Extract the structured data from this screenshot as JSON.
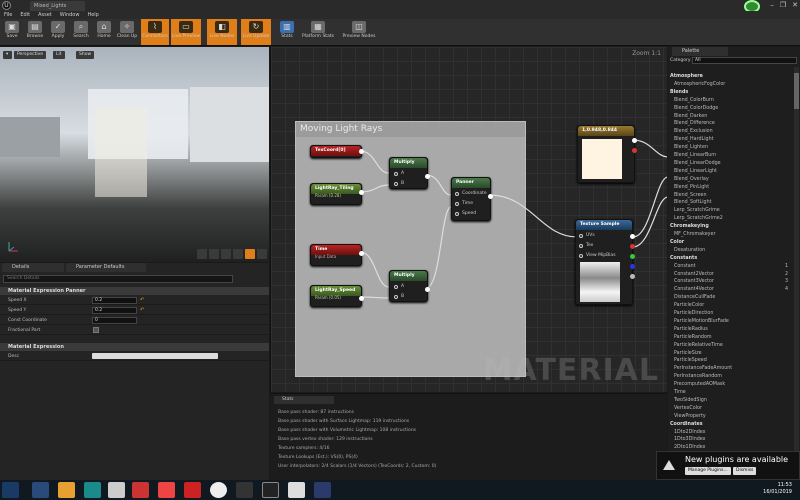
{
  "titlebar": {
    "tab_title": "Mixed_Lights",
    "window_controls": [
      "–",
      "❐",
      "✕"
    ]
  },
  "menu": [
    "File",
    "Edit",
    "Asset",
    "Window",
    "Help"
  ],
  "toolbar": [
    {
      "label": "Save",
      "icon": "save-icon",
      "active": false
    },
    {
      "label": "Browse",
      "icon": "browse-icon",
      "active": false
    },
    {
      "label": "Apply",
      "icon": "apply-icon",
      "active": false
    },
    {
      "label": "Search",
      "icon": "search-icon",
      "active": false
    },
    {
      "label": "Home",
      "icon": "home-icon",
      "active": false
    },
    {
      "label": "Clean Up",
      "icon": "cleanup-icon",
      "active": false
    },
    {
      "label": "Connectors",
      "icon": "connectors-icon",
      "active": true
    },
    {
      "label": "Live Preview",
      "icon": "live-preview-icon",
      "active": true
    },
    {
      "label": "Live Nodes",
      "icon": "live-nodes-icon",
      "active": true
    },
    {
      "label": "Live Update",
      "icon": "live-update-icon",
      "active": true
    },
    {
      "label": "Stats",
      "icon": "stats-icon",
      "active": false
    },
    {
      "label": "Platform Stats",
      "icon": "platform-stats-icon",
      "active": false
    },
    {
      "label": "Preview Nodes",
      "icon": "preview-nodes-icon",
      "active": false
    }
  ],
  "viewport": {
    "perspective": "Perspective",
    "lit": "Lit",
    "show": "Show"
  },
  "details": {
    "tab1": "Details",
    "tab2": "Parameter Defaults",
    "search_placeholder": "Search Details",
    "section1": "Material Expression Panner",
    "rows": [
      {
        "label": "Speed X",
        "value": "0.2"
      },
      {
        "label": "Speed Y",
        "value": "0.2"
      },
      {
        "label": "Const Coordinate",
        "value": "0"
      },
      {
        "label": "Fractional Part",
        "value": ""
      }
    ],
    "section2": "Material Expression",
    "desc_label": "Desc"
  },
  "graph": {
    "zoom": "Zoom 1:1",
    "watermark": "MATERIAL",
    "comment": "Moving Light Rays",
    "nodes": {
      "texcoord": "TexCoord[0]",
      "tiling": "LightRay_Tiling",
      "tiling_sub": "Param (0.28)",
      "time": "Time",
      "time_sub": "Input Data",
      "speed": "LightRay_Speed",
      "speed_sub": "Param (0.05)",
      "multiply1": "Multiply",
      "multiply2": "Multiply",
      "panner": "Panner",
      "pin_a": "A",
      "pin_b": "B",
      "pin_coordinate": "Coordinate",
      "pin_time": "Time",
      "pin_speed": "Speed",
      "color": "1,0.948,0.844",
      "texsample": "Texture Sample",
      "pin_uvs": "UVs",
      "pin_tex": "Tex",
      "pin_mip": "View MipBias"
    }
  },
  "log": {
    "tab": "Stats",
    "lines": [
      "Base pass shader: 87 instructions",
      "Base pass shader with Surface Lightmap: 119 instructions",
      "Base pass shader with Volumetric Lightmap: 108 instructions",
      "Base pass vertex shader: 129 instructions",
      "Texture samplers: 4/16",
      "Texture Lookups (Est.): VS(0), PS(4)",
      "User interpolators: 2/4 Scalars (1/4 Vectors) (TexCoords: 2, Custom: 0)"
    ]
  },
  "palette": {
    "tab": "Palette",
    "category_label": "Category",
    "category_value": "All",
    "items": [
      {
        "t": "cat",
        "l": "Atmosphere"
      },
      {
        "t": "item",
        "l": "AtmosphericFogColor"
      },
      {
        "t": "cat",
        "l": "Blends"
      },
      {
        "t": "item",
        "l": "Blend_ColorBurn"
      },
      {
        "t": "item",
        "l": "Blend_ColorDodge"
      },
      {
        "t": "item",
        "l": "Blend_Darken"
      },
      {
        "t": "item",
        "l": "Blend_Difference"
      },
      {
        "t": "item",
        "l": "Blend_Exclusion"
      },
      {
        "t": "item",
        "l": "Blend_HardLight"
      },
      {
        "t": "item",
        "l": "Blend_Lighten"
      },
      {
        "t": "item",
        "l": "Blend_LinearBurn"
      },
      {
        "t": "item",
        "l": "Blend_LinearDodge"
      },
      {
        "t": "item",
        "l": "Blend_LinearLight"
      },
      {
        "t": "item",
        "l": "Blend_Overlay"
      },
      {
        "t": "item",
        "l": "Blend_PinLight"
      },
      {
        "t": "item",
        "l": "Blend_Screen"
      },
      {
        "t": "item",
        "l": "Blend_SoftLight"
      },
      {
        "t": "item",
        "l": "Lerp_ScratchGrime"
      },
      {
        "t": "item",
        "l": "Lerp_ScratchGrime2"
      },
      {
        "t": "cat",
        "l": "Chromakeying"
      },
      {
        "t": "item",
        "l": "MF_Chromakeyer"
      },
      {
        "t": "cat",
        "l": "Color"
      },
      {
        "t": "item",
        "l": "Desaturation"
      },
      {
        "t": "cat",
        "l": "Constants"
      },
      {
        "t": "item",
        "l": "Constant",
        "n": "1"
      },
      {
        "t": "item",
        "l": "Constant2Vector",
        "n": "2"
      },
      {
        "t": "item",
        "l": "Constant3Vector",
        "n": "3"
      },
      {
        "t": "item",
        "l": "Constant4Vector",
        "n": "4"
      },
      {
        "t": "item",
        "l": "DistanceCullFade"
      },
      {
        "t": "item",
        "l": "ParticleColor"
      },
      {
        "t": "item",
        "l": "ParticleDirection"
      },
      {
        "t": "item",
        "l": "ParticleMotionBlurFade"
      },
      {
        "t": "item",
        "l": "ParticleRadius"
      },
      {
        "t": "item",
        "l": "ParticleRandom"
      },
      {
        "t": "item",
        "l": "ParticleRelativeTime"
      },
      {
        "t": "item",
        "l": "ParticleSize"
      },
      {
        "t": "item",
        "l": "ParticleSpeed"
      },
      {
        "t": "item",
        "l": "PerInstanceFadeAmount"
      },
      {
        "t": "item",
        "l": "PerInstanceRandom"
      },
      {
        "t": "item",
        "l": "PrecomputedAOMask"
      },
      {
        "t": "item",
        "l": "Time"
      },
      {
        "t": "item",
        "l": "TwoSidedSign"
      },
      {
        "t": "item",
        "l": "VertexColor"
      },
      {
        "t": "item",
        "l": "ViewProperty"
      },
      {
        "t": "cat",
        "l": "Coordinates"
      },
      {
        "t": "item",
        "l": "1Dto2DIndex"
      },
      {
        "t": "item",
        "l": "1Dto3DIndex"
      },
      {
        "t": "item",
        "l": "2Dto1DIndex"
      }
    ]
  },
  "notification": {
    "title": "New plugins are available",
    "manage": "Manage Plugins...",
    "dismiss": "Dismiss"
  },
  "taskbar": {
    "time": "11:53",
    "date": "16/01/2019"
  },
  "colors": {
    "accent": "#e07f1a",
    "bg": "#1a1a1a"
  }
}
